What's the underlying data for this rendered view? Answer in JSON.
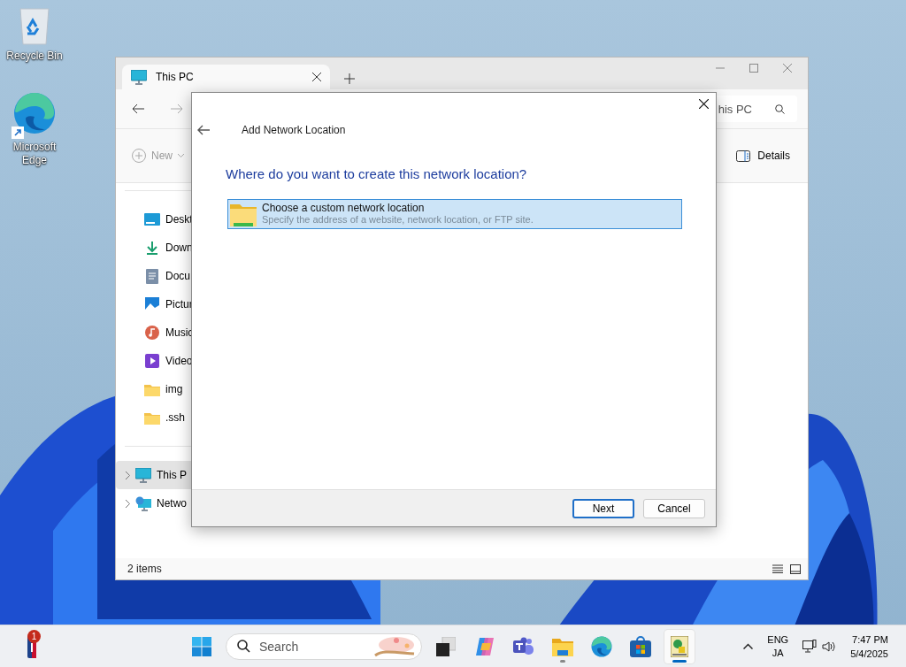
{
  "desktop_icons": [
    {
      "kind": "recycle-bin",
      "label": "Recycle Bin"
    },
    {
      "kind": "browser",
      "label": "Microsoft Edge"
    }
  ],
  "explorer": {
    "tabs": [
      {
        "title": "This PC",
        "selected": true
      }
    ],
    "search": {
      "value": "his PC"
    },
    "toolbar": {
      "new": "New",
      "details": "Details"
    },
    "sidebar": {
      "pinned": [
        {
          "kind": "desktop",
          "label": "Deskt"
        },
        {
          "kind": "download",
          "label": "Down"
        },
        {
          "kind": "document",
          "label": "Docu"
        },
        {
          "kind": "pictures",
          "label": "Pictur"
        },
        {
          "kind": "music",
          "label": "Music"
        },
        {
          "kind": "video",
          "label": "Video"
        },
        {
          "kind": "folder",
          "label": "img"
        },
        {
          "kind": "folder",
          "label": ".ssh"
        }
      ],
      "locations": [
        {
          "kind": "pc",
          "label": "This P",
          "selected": true
        },
        {
          "kind": "network",
          "label": "Netwo",
          "selected": false
        }
      ]
    },
    "status_bar": "2 items"
  },
  "dialog": {
    "title": "Add Network Location",
    "heading": "Where do you want to create this network location?",
    "options": [
      {
        "title": "Choose a custom network location",
        "description": "Specify the address of a website, network location, or FTP site.",
        "selected": true
      }
    ],
    "buttons": [
      {
        "label": "Next",
        "default": true
      },
      {
        "label": "Cancel",
        "default": false
      }
    ]
  },
  "taskbar": {
    "widget_badge": "1",
    "search_placeholder": "Search",
    "apps": [
      {
        "kind": "task-view",
        "running": false,
        "selected": false
      },
      {
        "kind": "assistant",
        "running": false,
        "selected": false
      },
      {
        "kind": "chat",
        "running": false,
        "selected": false
      },
      {
        "kind": "files",
        "running": true,
        "selected": false
      },
      {
        "kind": "browser",
        "running": false,
        "selected": false
      },
      {
        "kind": "store",
        "running": false,
        "selected": false
      },
      {
        "kind": "network-wizard",
        "running": true,
        "selected": true
      }
    ],
    "tray": {
      "language": "ENG",
      "input": "JA",
      "time": "7:47 PM",
      "date": "5/4/2025"
    }
  }
}
